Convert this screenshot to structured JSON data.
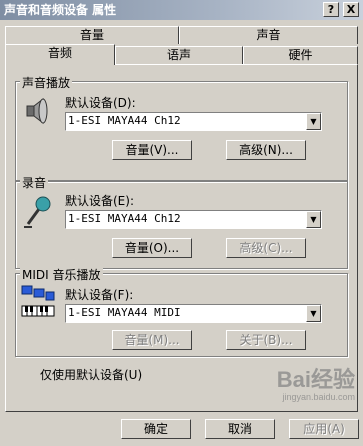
{
  "window": {
    "title": "声音和音频设备 属性",
    "help_button": "?",
    "close_button": "X"
  },
  "tabs_top": [
    "音量",
    "声音"
  ],
  "tabs_bottom": [
    "音频",
    "语声",
    "硬件"
  ],
  "playback": {
    "group_title": "声音播放",
    "label": "默认设备(D):",
    "device": "1-ESI MAYA44 Ch12",
    "volume_button": "音量(V)...",
    "advanced_button": "高级(N)..."
  },
  "recording": {
    "group_title": "录音",
    "label": "默认设备(E):",
    "device": "1-ESI MAYA44 Ch12",
    "volume_button": "音量(O)...",
    "advanced_button": "高级(C)..."
  },
  "midi": {
    "group_title": "MIDI 音乐播放",
    "label": "默认设备(F):",
    "device": "1-ESI MAYA44 MIDI",
    "volume_button": "音量(M)...",
    "about_button": "关于(B)..."
  },
  "options": {
    "only_default_label": "仅使用默认设备(U)",
    "only_default_checked": true
  },
  "footer": {
    "ok": "确定",
    "cancel": "取消",
    "apply": "应用(A)"
  },
  "watermark": {
    "brand": "Bai经验",
    "url": "jingyan.baidu.com"
  },
  "colors": {
    "title_bar": "#7f8ea3",
    "dialog_bg": "#d4d0c8",
    "annotation_red": "#e1081a"
  }
}
